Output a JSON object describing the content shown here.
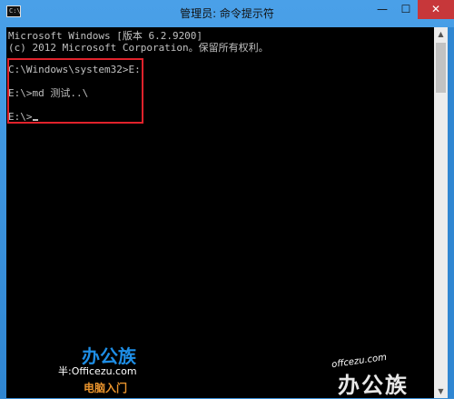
{
  "window": {
    "title": "管理员: 命令提示符",
    "icon_text": "C:\\",
    "buttons": {
      "minimize": "—",
      "maximize": "☐",
      "close": "✕"
    }
  },
  "console": {
    "lines": [
      "Microsoft Windows [版本 6.2.9200]",
      "(c) 2012 Microsoft Corporation。保留所有权利。",
      "C:\\Windows\\system32>E:",
      "E:\\>md 测试..\\",
      "E:\\>"
    ]
  },
  "scrollbar": {
    "up_glyph": "▲",
    "down_glyph": "▼"
  },
  "watermarks": {
    "brand_cn": "办公族",
    "site": "半:Officezu.com",
    "tagline": "电脑入门",
    "site_right": "offcezu.com",
    "brand_right": "办公族"
  },
  "colors": {
    "highlight": "#e0222b",
    "console_bg": "#000000",
    "console_text": "#c0c0c0",
    "close_button": "#c7373a"
  }
}
